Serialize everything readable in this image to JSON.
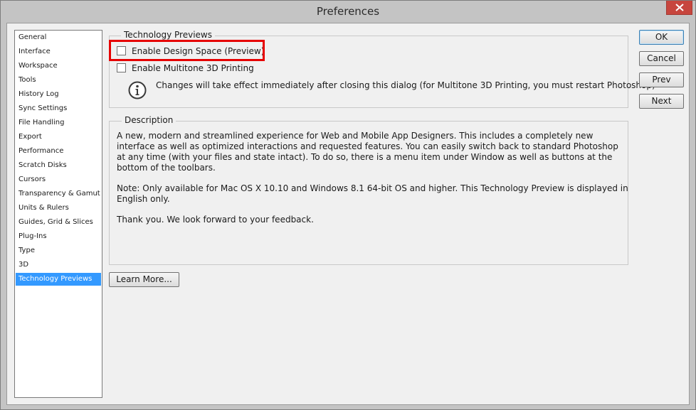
{
  "window": {
    "title": "Preferences"
  },
  "sidebar": {
    "items": [
      {
        "label": "General"
      },
      {
        "label": "Interface"
      },
      {
        "label": "Workspace"
      },
      {
        "label": "Tools"
      },
      {
        "label": "History Log"
      },
      {
        "label": "Sync Settings"
      },
      {
        "label": "File Handling"
      },
      {
        "label": "Export"
      },
      {
        "label": "Performance"
      },
      {
        "label": "Scratch Disks"
      },
      {
        "label": "Cursors"
      },
      {
        "label": "Transparency & Gamut"
      },
      {
        "label": "Units & Rulers"
      },
      {
        "label": "Guides, Grid & Slices"
      },
      {
        "label": "Plug-Ins"
      },
      {
        "label": "Type"
      },
      {
        "label": "3D"
      },
      {
        "label": "Technology Previews",
        "selected": true
      }
    ]
  },
  "tech_previews": {
    "group_title": "Technology Previews",
    "design_space_label": "Enable Design Space (Preview)",
    "design_space_checked": false,
    "multitone_label": "Enable Multitone 3D Printing",
    "multitone_checked": false,
    "info_text": "Changes will take effect immediately after closing this dialog (for Multitone 3D Printing, you must restart Photoshop)"
  },
  "description": {
    "group_title": "Description",
    "para1": "A new, modern and streamlined experience for Web and Mobile App Designers. This includes a completely new interface as well as optimized interactions and requested features. You can easily switch back to standard Photoshop at any time (with your files and state intact). To do so, there is a menu item under Window as well as buttons at the bottom of the toolbars.",
    "para2": "Note: Only available for Mac OS X 10.10 and Windows 8.1 64-bit OS and higher.  This Technology Preview is displayed in English only.",
    "para3": "Thank you. We look forward to your feedback."
  },
  "buttons": {
    "learn_more": "Learn More...",
    "ok": "OK",
    "cancel": "Cancel",
    "prev": "Prev",
    "next": "Next"
  },
  "colors": {
    "highlight": "#e60000",
    "selection": "#3399ff",
    "close_button": "#c7463e"
  }
}
